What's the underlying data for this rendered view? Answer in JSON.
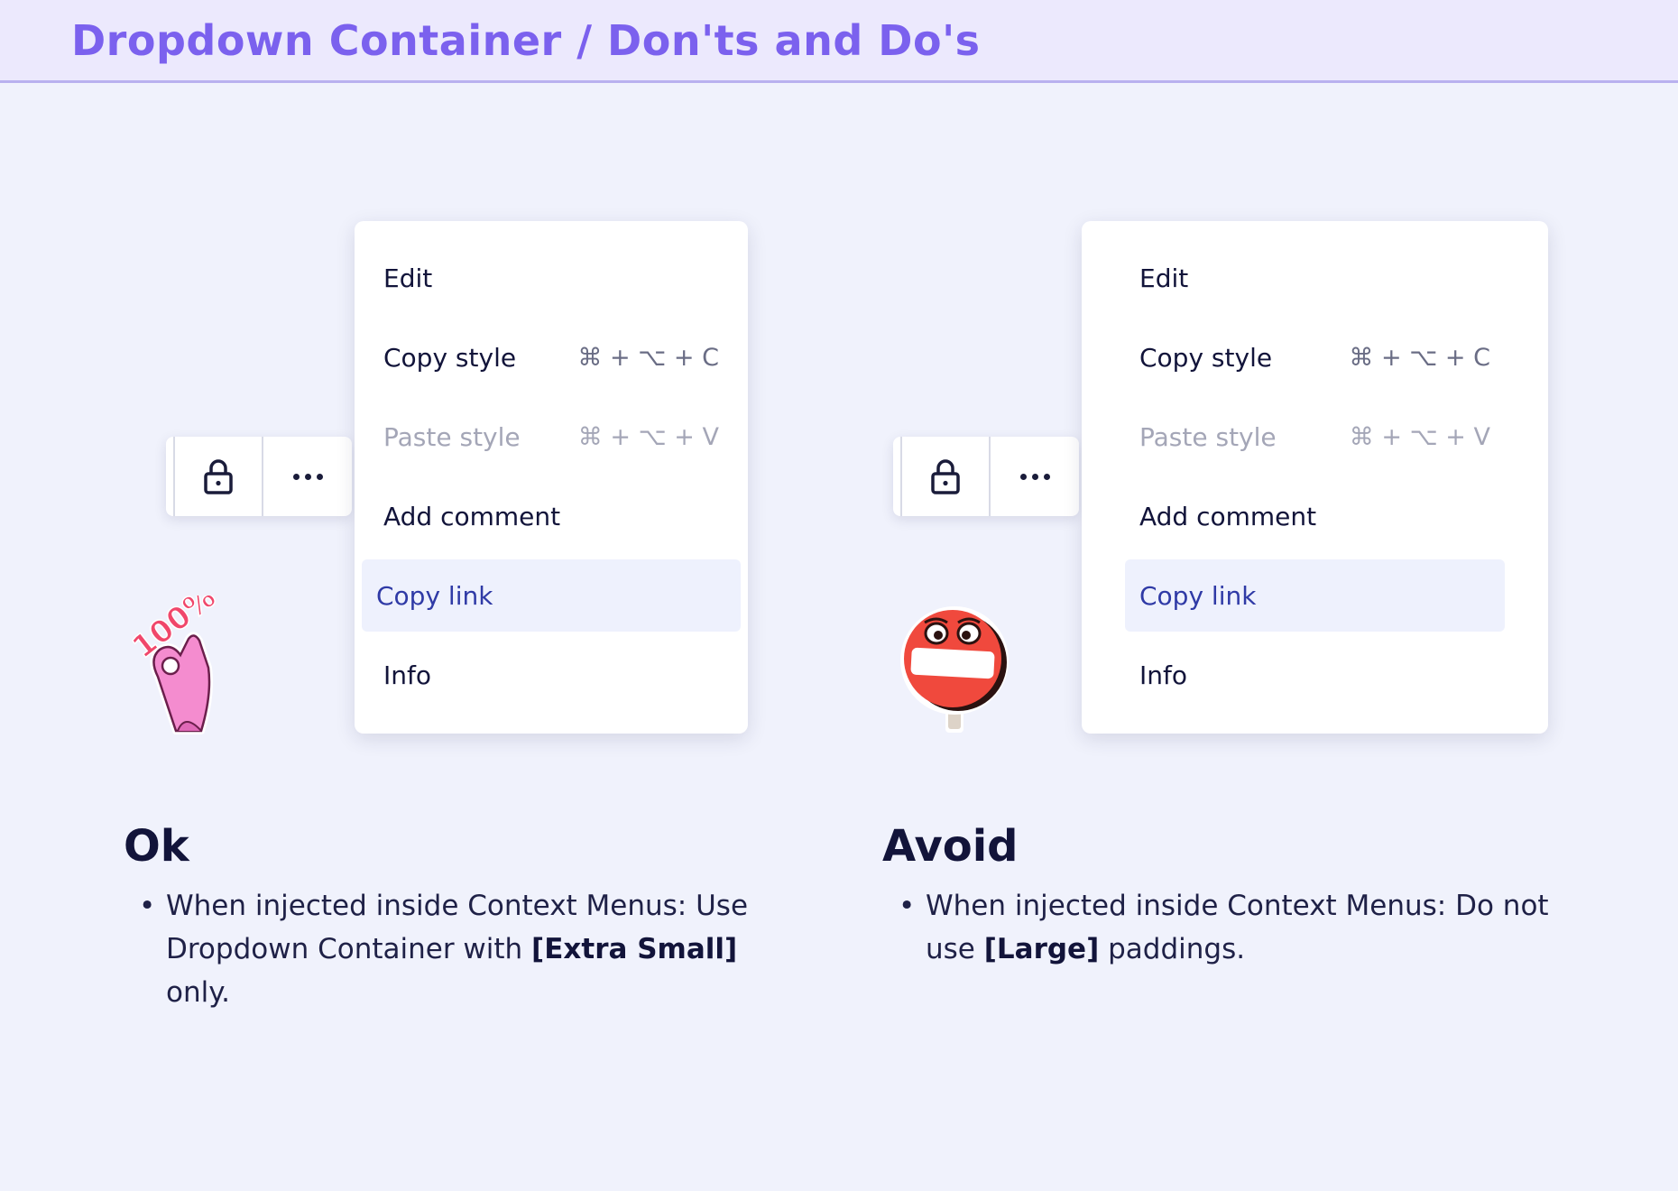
{
  "header": {
    "title": "Dropdown Container / Don'ts and Do's"
  },
  "menu_items": [
    {
      "label": "Edit",
      "shortcut": ""
    },
    {
      "label": "Copy style",
      "shortcut": "⌘ + ⌥ + C"
    },
    {
      "label": "Paste style",
      "shortcut": "⌘ + ⌥ + V",
      "state": "disabled"
    },
    {
      "label": "Add comment",
      "shortcut": ""
    },
    {
      "label": "Copy link",
      "shortcut": "",
      "state": "active"
    },
    {
      "label": "Info",
      "shortcut": ""
    }
  ],
  "toolbar": {
    "icons": [
      "lock-icon",
      "more-horizontal-icon"
    ]
  },
  "ok": {
    "sticker": "ok-hand-100-sticker",
    "sticker_text": "100%",
    "title": "Ok",
    "bullet_pre": "When injected inside Context Menus: Use Dropdown Container with ",
    "bullet_bold": "[Extra Small]",
    "bullet_post": " only."
  },
  "avoid": {
    "sticker": "no-entry-sign-sticker",
    "title": "Avoid",
    "bullet_pre": "When injected inside Context Menus: Do not use ",
    "bullet_bold": "[Large]",
    "bullet_post": " paddings."
  },
  "colors": {
    "header_bg": "#ece9fd",
    "header_text": "#7b61ee",
    "page_bg": "#f0f2fc",
    "active_bg": "#eef1fd",
    "active_text": "#2f3aa6",
    "disabled_text": "#a4a6b7"
  }
}
